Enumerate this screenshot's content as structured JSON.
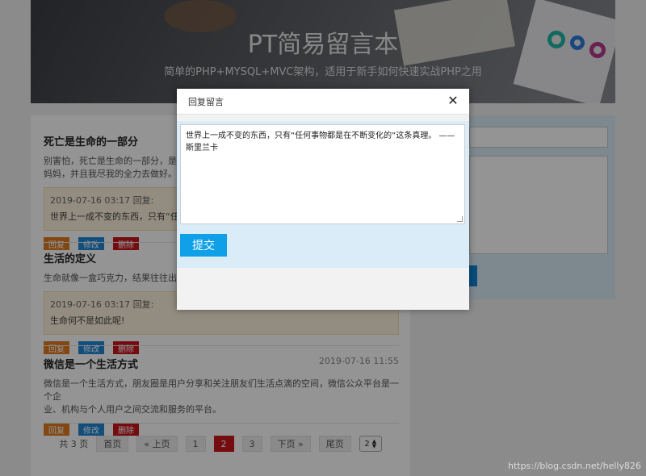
{
  "header": {
    "title": "PT简易留言本",
    "subtitle": "简单的PHP+MYSQL+MVC架构，适用于新手如何快速实战PHP之用"
  },
  "posts": [
    {
      "title": "死亡是生命的一部分",
      "body": "别害怕，死亡是生命的一部分，是我",
      "body2": "妈妈，并且我尽我的全力去做好。",
      "reply_time": "2019-07-16 03:17 回复:",
      "reply_content": "世界上一成不变的东西，只有“任何",
      "buttons": {
        "reply": "回复",
        "edit": "修改",
        "delete": "删除"
      }
    },
    {
      "title": "生活的定义",
      "body": "生命就像一盒巧克力，结果往往出人意",
      "reply_time": "2019-07-16 03:17 回复:",
      "reply_content": "生命何不是如此呢!",
      "buttons": {
        "reply": "回复",
        "edit": "修改",
        "delete": "删除"
      }
    },
    {
      "title": "微信是一个生活方式",
      "time": "2019-07-16 11:55",
      "body": "微信是一个生活方式，朋友圈是用户分享和关注朋友们生活点滴的空间，微信公众平台是一个企",
      "body2": "业、机构与个人用户之间交流和服务的平台。",
      "buttons": {
        "reply": "回复",
        "edit": "修改",
        "delete": "删除"
      }
    }
  ],
  "pager": {
    "total": "共 3 页",
    "first": "首页",
    "prev": "« 上页",
    "pages": [
      "1",
      "2",
      "3"
    ],
    "current": "2",
    "next": "下页 »",
    "last": "尾页",
    "select_value": "2"
  },
  "modal": {
    "title": "回复留言",
    "close": "✕",
    "textarea_value": "世界上一成不变的东西，只有“任何事物都是在不断变化的”这条真理。 —— 斯里兰卡",
    "submit": "提交"
  },
  "watermark": "https://blog.csdn.net/helly826",
  "colors": {
    "reply_button": "#e07b1f",
    "edit_button": "#1e87d6",
    "delete_button": "#c8161d",
    "submit_button": "#0fa0e8",
    "active_page": "#c8161d"
  }
}
